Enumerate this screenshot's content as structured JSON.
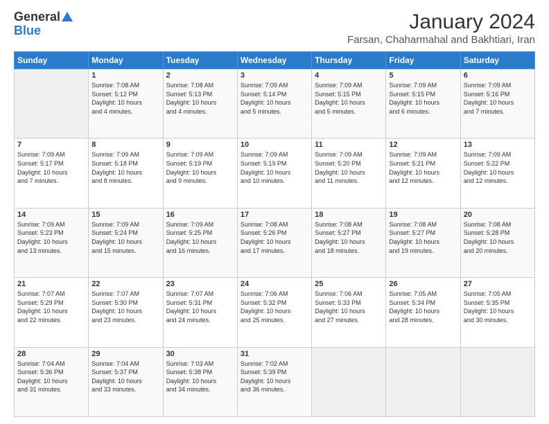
{
  "logo": {
    "line1": "General",
    "line2": "Blue"
  },
  "title": "January 2024",
  "subtitle": "Farsan, Chaharmahal and Bakhtiari, Iran",
  "days_of_week": [
    "Sunday",
    "Monday",
    "Tuesday",
    "Wednesday",
    "Thursday",
    "Friday",
    "Saturday"
  ],
  "weeks": [
    [
      {
        "day": "",
        "info": ""
      },
      {
        "day": "1",
        "info": "Sunrise: 7:08 AM\nSunset: 5:12 PM\nDaylight: 10 hours\nand 4 minutes."
      },
      {
        "day": "2",
        "info": "Sunrise: 7:08 AM\nSunset: 5:13 PM\nDaylight: 10 hours\nand 4 minutes."
      },
      {
        "day": "3",
        "info": "Sunrise: 7:09 AM\nSunset: 5:14 PM\nDaylight: 10 hours\nand 5 minutes."
      },
      {
        "day": "4",
        "info": "Sunrise: 7:09 AM\nSunset: 5:15 PM\nDaylight: 10 hours\nand 5 minutes."
      },
      {
        "day": "5",
        "info": "Sunrise: 7:09 AM\nSunset: 5:15 PM\nDaylight: 10 hours\nand 6 minutes."
      },
      {
        "day": "6",
        "info": "Sunrise: 7:09 AM\nSunset: 5:16 PM\nDaylight: 10 hours\nand 7 minutes."
      }
    ],
    [
      {
        "day": "7",
        "info": "Sunrise: 7:09 AM\nSunset: 5:17 PM\nDaylight: 10 hours\nand 7 minutes."
      },
      {
        "day": "8",
        "info": "Sunrise: 7:09 AM\nSunset: 5:18 PM\nDaylight: 10 hours\nand 8 minutes."
      },
      {
        "day": "9",
        "info": "Sunrise: 7:09 AM\nSunset: 5:19 PM\nDaylight: 10 hours\nand 9 minutes."
      },
      {
        "day": "10",
        "info": "Sunrise: 7:09 AM\nSunset: 5:19 PM\nDaylight: 10 hours\nand 10 minutes."
      },
      {
        "day": "11",
        "info": "Sunrise: 7:09 AM\nSunset: 5:20 PM\nDaylight: 10 hours\nand 11 minutes."
      },
      {
        "day": "12",
        "info": "Sunrise: 7:09 AM\nSunset: 5:21 PM\nDaylight: 10 hours\nand 12 minutes."
      },
      {
        "day": "13",
        "info": "Sunrise: 7:09 AM\nSunset: 5:22 PM\nDaylight: 10 hours\nand 12 minutes."
      }
    ],
    [
      {
        "day": "14",
        "info": "Sunrise: 7:09 AM\nSunset: 5:23 PM\nDaylight: 10 hours\nand 13 minutes."
      },
      {
        "day": "15",
        "info": "Sunrise: 7:09 AM\nSunset: 5:24 PM\nDaylight: 10 hours\nand 15 minutes."
      },
      {
        "day": "16",
        "info": "Sunrise: 7:09 AM\nSunset: 5:25 PM\nDaylight: 10 hours\nand 16 minutes."
      },
      {
        "day": "17",
        "info": "Sunrise: 7:08 AM\nSunset: 5:26 PM\nDaylight: 10 hours\nand 17 minutes."
      },
      {
        "day": "18",
        "info": "Sunrise: 7:08 AM\nSunset: 5:27 PM\nDaylight: 10 hours\nand 18 minutes."
      },
      {
        "day": "19",
        "info": "Sunrise: 7:08 AM\nSunset: 5:27 PM\nDaylight: 10 hours\nand 19 minutes."
      },
      {
        "day": "20",
        "info": "Sunrise: 7:08 AM\nSunset: 5:28 PM\nDaylight: 10 hours\nand 20 minutes."
      }
    ],
    [
      {
        "day": "21",
        "info": "Sunrise: 7:07 AM\nSunset: 5:29 PM\nDaylight: 10 hours\nand 22 minutes."
      },
      {
        "day": "22",
        "info": "Sunrise: 7:07 AM\nSunset: 5:30 PM\nDaylight: 10 hours\nand 23 minutes."
      },
      {
        "day": "23",
        "info": "Sunrise: 7:07 AM\nSunset: 5:31 PM\nDaylight: 10 hours\nand 24 minutes."
      },
      {
        "day": "24",
        "info": "Sunrise: 7:06 AM\nSunset: 5:32 PM\nDaylight: 10 hours\nand 25 minutes."
      },
      {
        "day": "25",
        "info": "Sunrise: 7:06 AM\nSunset: 5:33 PM\nDaylight: 10 hours\nand 27 minutes."
      },
      {
        "day": "26",
        "info": "Sunrise: 7:05 AM\nSunset: 5:34 PM\nDaylight: 10 hours\nand 28 minutes."
      },
      {
        "day": "27",
        "info": "Sunrise: 7:05 AM\nSunset: 5:35 PM\nDaylight: 10 hours\nand 30 minutes."
      }
    ],
    [
      {
        "day": "28",
        "info": "Sunrise: 7:04 AM\nSunset: 5:36 PM\nDaylight: 10 hours\nand 31 minutes."
      },
      {
        "day": "29",
        "info": "Sunrise: 7:04 AM\nSunset: 5:37 PM\nDaylight: 10 hours\nand 33 minutes."
      },
      {
        "day": "30",
        "info": "Sunrise: 7:03 AM\nSunset: 5:38 PM\nDaylight: 10 hours\nand 34 minutes."
      },
      {
        "day": "31",
        "info": "Sunrise: 7:02 AM\nSunset: 5:39 PM\nDaylight: 10 hours\nand 36 minutes."
      },
      {
        "day": "",
        "info": ""
      },
      {
        "day": "",
        "info": ""
      },
      {
        "day": "",
        "info": ""
      }
    ]
  ]
}
